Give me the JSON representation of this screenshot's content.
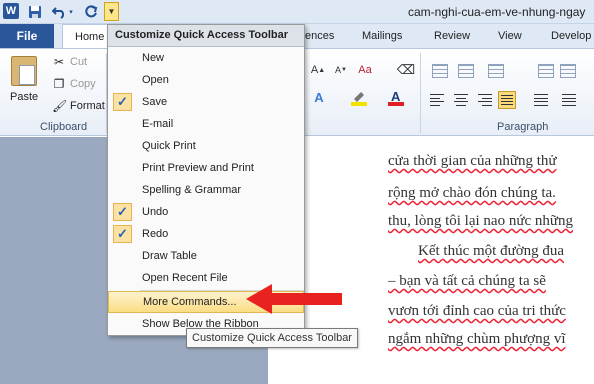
{
  "titlebar": {
    "app_icon": "W",
    "document_title": "cam-nghi-cua-em-ve-nhung-ngay",
    "qat": [
      {
        "name": "save-icon",
        "glyph": "💾"
      },
      {
        "name": "undo-icon",
        "glyph": "↶"
      },
      {
        "name": "redo-icon",
        "glyph": "↻"
      }
    ],
    "qat_dropdown_glyph": "▼"
  },
  "tabs": {
    "file": "File",
    "home": "Home",
    "references_partial": "ences",
    "mailings": "Mailings",
    "review": "Review",
    "view": "View",
    "developer_partial": "Develop"
  },
  "ribbon": {
    "clipboard": {
      "label": "Clipboard",
      "paste": "Paste",
      "cut": "Cut",
      "copy": "Copy",
      "format": "Format"
    },
    "paragraph": {
      "label": "Paragraph"
    },
    "font": {
      "highlight_color": "#f5e100",
      "font_color": "#e02020"
    }
  },
  "menu": {
    "title": "Customize Quick Access Toolbar",
    "items": [
      {
        "label": "New",
        "checked": false
      },
      {
        "label": "Open",
        "checked": false
      },
      {
        "label": "Save",
        "checked": true
      },
      {
        "label": "E-mail",
        "checked": false
      },
      {
        "label": "Quick Print",
        "checked": false
      },
      {
        "label": "Print Preview and Print",
        "checked": false
      },
      {
        "label": "Spelling & Grammar",
        "checked": false
      },
      {
        "label": "Undo",
        "checked": true
      },
      {
        "label": "Redo",
        "checked": true
      },
      {
        "label": "Draw Table",
        "checked": false
      },
      {
        "label": "Open Recent File",
        "checked": false
      },
      {
        "label": "More Commands...",
        "checked": false,
        "highlighted": true
      },
      {
        "label": "Show Below the Ribbon",
        "checked": false
      }
    ],
    "check_glyph": "✓"
  },
  "tooltip": "Customize Quick Access Toolbar",
  "document": {
    "lines": [
      "cửa thời gian của những thử",
      "rộng mở chào đón chúng ta. ",
      "thu, lòng tôi lại nao nức những",
      "Kết thúc một đường đua",
      "– bạn và tất cả chúng ta sẽ",
      "vươn tới đỉnh cao của tri thức",
      "ngắm những chùm phượng vĩ"
    ]
  },
  "accent_colors": {
    "file_tab": "#2b579a",
    "highlight": "#fbdd84",
    "arrow": "#e8231f"
  }
}
